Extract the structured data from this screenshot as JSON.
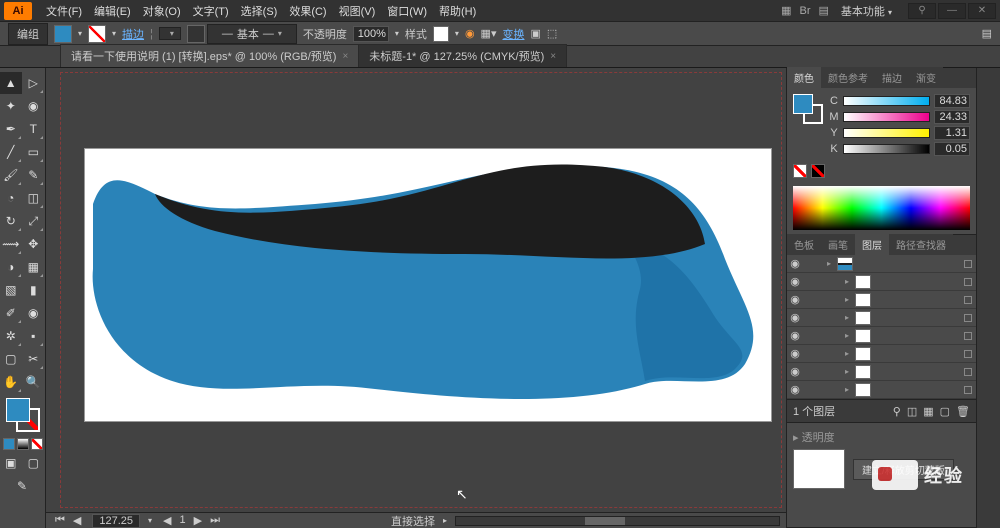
{
  "menu": {
    "items": [
      "文件(F)",
      "编辑(E)",
      "对象(O)",
      "文字(T)",
      "选择(S)",
      "效果(C)",
      "视图(V)",
      "窗口(W)",
      "帮助(H)"
    ],
    "workspace": "基本功能"
  },
  "control": {
    "mode": "编组",
    "stroke_link": "描边",
    "stroke_pt": "",
    "basic": "基本",
    "opacity_label": "不透明度",
    "opacity": "100%",
    "style_label": "样式",
    "transform_link": "变换"
  },
  "tabs": [
    {
      "label": "请看一下使用说明 (1) [转换].eps* @ 100% (RGB/预览)",
      "active": false
    },
    {
      "label": "未标题-1* @ 127.25% (CMYK/预览)",
      "active": true
    }
  ],
  "color": {
    "tabs": [
      "颜色",
      "颜色参考",
      "描边",
      "渐变"
    ],
    "active": 0,
    "channels": [
      {
        "l": "C",
        "v": "84.83"
      },
      {
        "l": "M",
        "v": "24.33"
      },
      {
        "l": "Y",
        "v": "1.31"
      },
      {
        "l": "K",
        "v": "0.05"
      }
    ]
  },
  "layers_panel": {
    "tabs": [
      "色板",
      "画笔",
      "图层",
      "路径查找器"
    ],
    "active": 2,
    "count_label": "1 个图层",
    "mask_btn": "建立/释放剪切蒙版"
  },
  "layers": [
    {
      "indent": 0,
      "thumb": "t1"
    },
    {
      "indent": 1,
      "thumb": ""
    },
    {
      "indent": 1,
      "thumb": ""
    },
    {
      "indent": 1,
      "thumb": ""
    },
    {
      "indent": 1,
      "thumb": ""
    },
    {
      "indent": 1,
      "thumb": ""
    },
    {
      "indent": 1,
      "thumb": ""
    },
    {
      "indent": 1,
      "thumb": ""
    }
  ],
  "status": {
    "zoom": "127.25",
    "tool": "直接选择"
  },
  "watermark": "经验"
}
